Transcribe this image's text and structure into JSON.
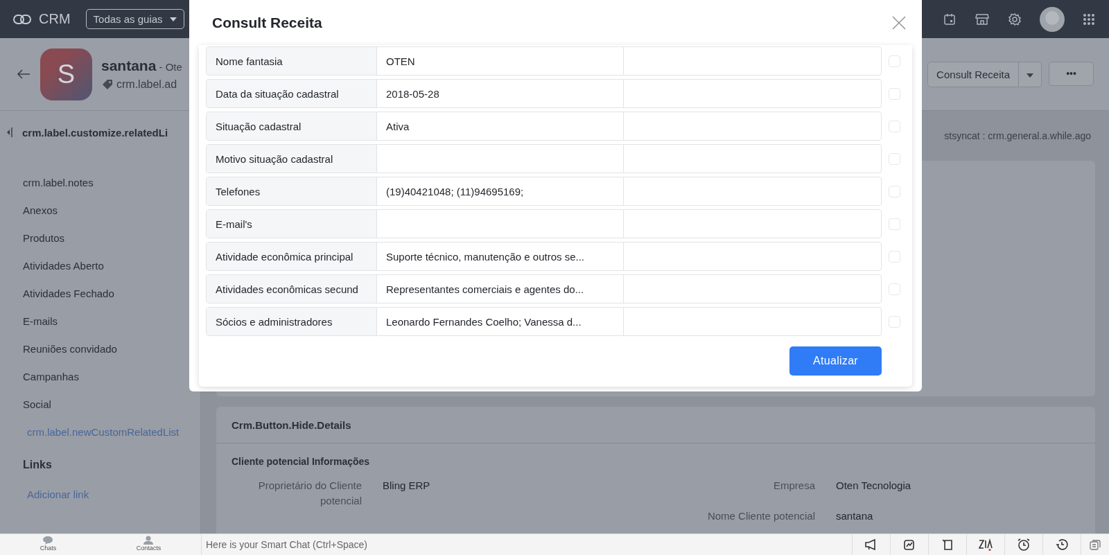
{
  "topbar": {
    "app_name": "CRM",
    "tabs_menu": "Todas as guias"
  },
  "record": {
    "initial": "S",
    "name": "santana",
    "company": "- Ote",
    "tag": "crm.label.ad"
  },
  "record_actions": {
    "primary": "Consult Receita",
    "more": "•••"
  },
  "sidebar": {
    "title": "crm.label.customize.relatedLi",
    "items": [
      "crm.label.notes",
      "Anexos",
      "Produtos",
      "Atividades Aberto",
      "Atividades Fechado",
      "E-mails",
      "Reuniões convidado",
      "Campanhas",
      "Social"
    ],
    "custom_link": "crm.label.newCustomRelatedList",
    "links_title": "Links",
    "add_link": "Adicionar link"
  },
  "main": {
    "sync_text": "stsyncat : crm.general.a.while.ago",
    "details_toggle": "Crm.Button.Hide.Details",
    "section_title": "Cliente potencial Informações",
    "left_fields": [
      {
        "label": "Proprietário do Cliente potencial",
        "value": "Bling ERP"
      }
    ],
    "right_fields": [
      {
        "label": "Empresa",
        "value": "Oten Tecnologia"
      },
      {
        "label": "Nome Cliente potencial",
        "value": "santana"
      }
    ]
  },
  "modal": {
    "title": "Consult Receita",
    "rows": [
      {
        "label": "Nome fantasia",
        "value": "OTEN",
        "checked": false
      },
      {
        "label": "Data da situação cadastral",
        "value": "2018-05-28",
        "checked": false
      },
      {
        "label": "Situação cadastral",
        "value": "Ativa",
        "checked": false
      },
      {
        "label": "Motivo situação cadastral",
        "value": "",
        "checked": false
      },
      {
        "label": "Telefones",
        "value": "(19)40421048; (11)94695169;",
        "checked": false
      },
      {
        "label": "E-mail's",
        "value": "",
        "checked": false
      },
      {
        "label": "Atividade econômica principal",
        "value": "Suporte técnico, manutenção e outros se...",
        "checked": false
      },
      {
        "label": "Atividades econômicas secund",
        "value": "Representantes comerciais e agentes do...",
        "checked": false
      },
      {
        "label": "Sócios e administradores",
        "value": "Leonardo Fernandes Coelho; Vanessa d...",
        "checked": false
      }
    ],
    "button": "Atualizar"
  },
  "bottom_bar": {
    "chats": "Chats",
    "contacts": "Contacts",
    "smart_chat_placeholder": "Here is your Smart Chat (Ctrl+Space)"
  }
}
